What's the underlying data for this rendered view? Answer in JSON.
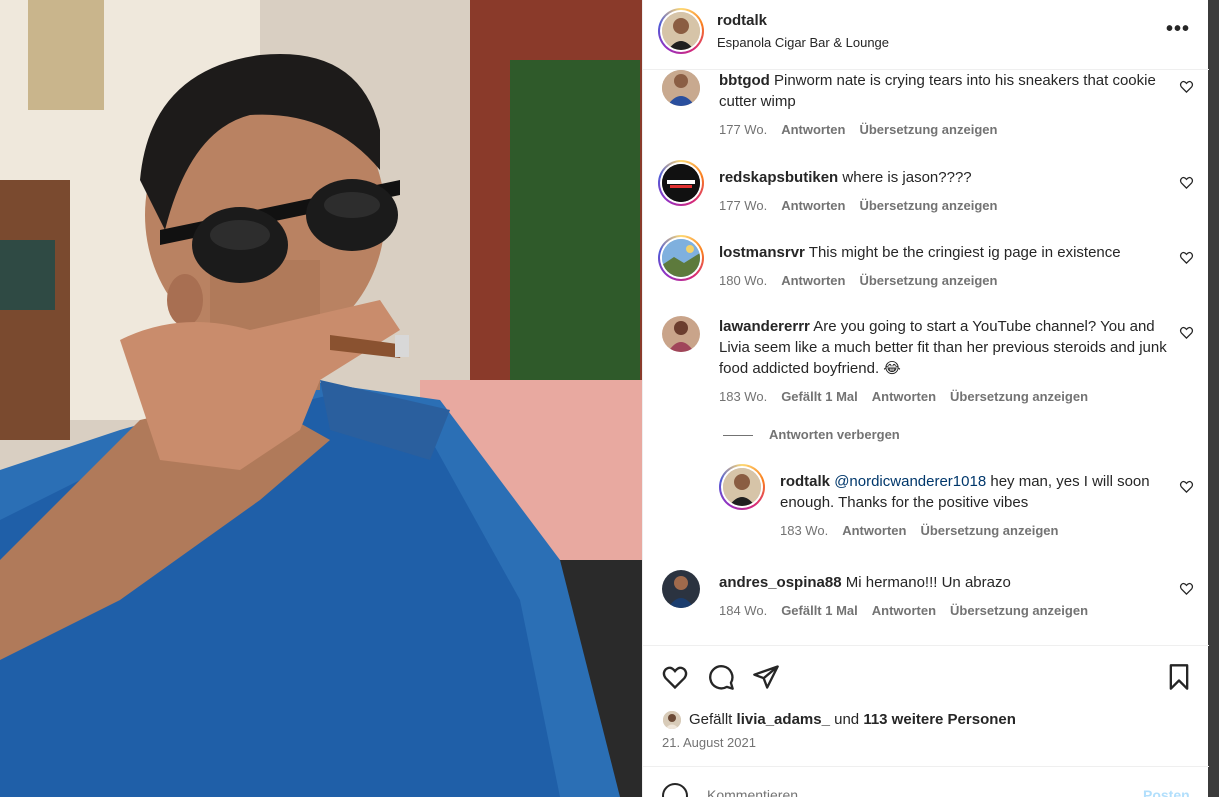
{
  "header": {
    "username": "rodtalk",
    "location": "Espanola Cigar Bar & Lounge",
    "more_icon": "more-horizontal-icon",
    "more_label": "•••"
  },
  "comments": [
    {
      "username": "bbtgod",
      "text": "Pinworm nate is crying tears into his sneakers that cookie cutter wimp",
      "age": "177 Wo.",
      "reply": "Antworten",
      "translate": "Übersetzung anzeigen"
    },
    {
      "username": "redskapsbutiken",
      "text": "where is jason????",
      "age": "177 Wo.",
      "reply": "Antworten",
      "translate": "Übersetzung anzeigen"
    },
    {
      "username": "lostmansrvr",
      "text": "This might be the cringiest ig page in existence",
      "age": "180 Wo.",
      "reply": "Antworten",
      "translate": "Übersetzung anzeigen"
    },
    {
      "username": "lawandererrr",
      "text": "Are you going to start a YouTube channel? You and Livia seem like a much better fit than her previous steroids and junk food addicted boyfriend. 😂",
      "age": "183 Wo.",
      "likes": "Gefällt 1 Mal",
      "reply": "Antworten",
      "translate": "Übersetzung anzeigen"
    },
    {
      "username": "andres_ospina88",
      "text": "Mi hermano!!! Un abrazo",
      "age": "184 Wo.",
      "likes": "Gefällt 1 Mal",
      "reply": "Antworten",
      "translate": "Übersetzung anzeigen"
    }
  ],
  "hide_replies": "Antworten verbergen",
  "reply_comment": {
    "username": "rodtalk",
    "mention": "@nordicwanderer1018",
    "text": "hey man, yes I will soon enough. Thanks for the positive vibes",
    "age": "183 Wo.",
    "reply": "Antworten",
    "translate": "Übersetzung anzeigen"
  },
  "actions": {
    "icons": [
      "heart-icon",
      "comment-icon",
      "share-icon",
      "bookmark-icon"
    ]
  },
  "likes": {
    "prefix": "Gefällt",
    "user": "livia_adams_",
    "middle": "und",
    "others": "113 weitere Personen"
  },
  "date": "21. August 2021",
  "comment_box": {
    "placeholder": "Kommentieren ...",
    "post_label": "Posten"
  },
  "colors": {
    "text": "#262626",
    "secondary": "#737373",
    "link": "#00376b",
    "post_disabled": "#b2dffc"
  }
}
